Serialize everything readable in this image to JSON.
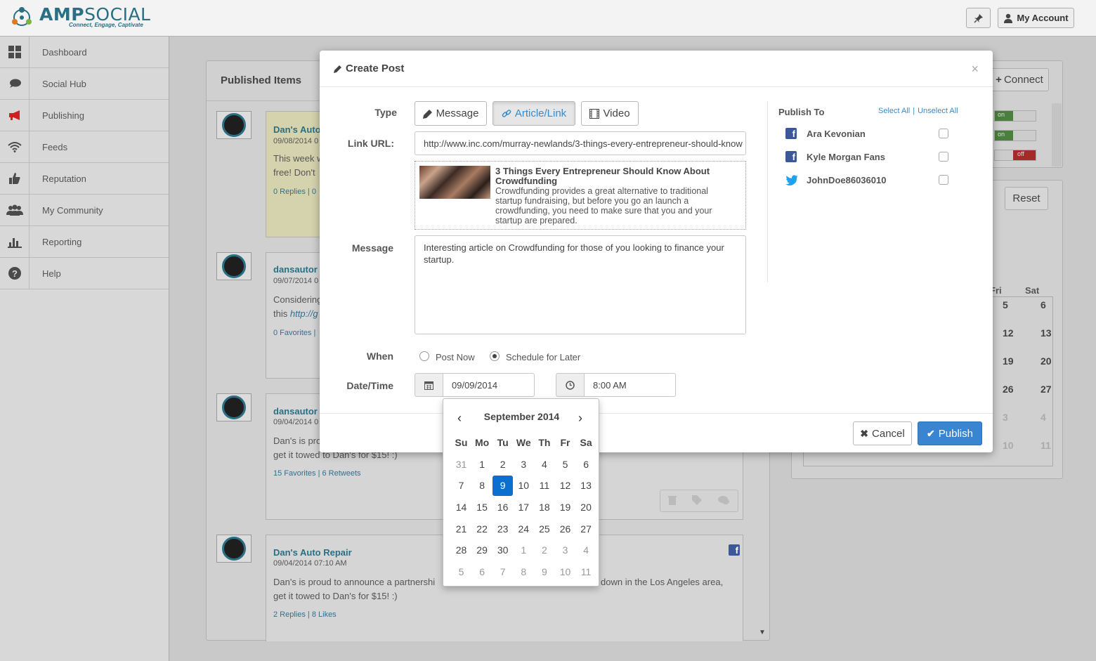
{
  "app": {
    "logo_amp": "AMP",
    "logo_social": "SOCIAL",
    "tagline": "Connect, Engage, Captivate",
    "my_account": "My Account"
  },
  "sidebar": {
    "items": [
      {
        "label": "Dashboard",
        "icon": "dashboard-icon"
      },
      {
        "label": "Social Hub",
        "icon": "chat-icon"
      },
      {
        "label": "Publishing",
        "icon": "megaphone-icon"
      },
      {
        "label": "Feeds",
        "icon": "wifi-icon"
      },
      {
        "label": "Reputation",
        "icon": "thumbs-up-icon"
      },
      {
        "label": "My Community",
        "icon": "users-icon"
      },
      {
        "label": "Reporting",
        "icon": "bar-chart-icon"
      },
      {
        "label": "Help",
        "icon": "question-icon"
      }
    ]
  },
  "published": {
    "title": "Published Items",
    "posts": [
      {
        "author": "Dan's Auto",
        "date": "09/08/2014 0",
        "text1": "This week w",
        "text2": "free! Don't",
        "stats": "0 Replies | 0"
      },
      {
        "author": "dansautor",
        "date": "09/07/2014 0",
        "text1": "Considering",
        "text2": "this",
        "link": "http://g",
        "stats": "0 Favorites |"
      },
      {
        "author": "dansautor",
        "date": "09/04/2014 0",
        "text1": "Dan's is pro",
        "text2": "get it towed to Dan's for $15! :)",
        "stats": "15 Favorites | 6 Retweets"
      },
      {
        "author": "Dan's Auto Repair",
        "date": "09/04/2014 07:10 AM",
        "text1": "Dan's is proud to announce a partnershi",
        "text1b": "down in the Los Angeles area,",
        "text2": "get it towed to Dan's for $15! :)",
        "stats": "2 Replies | 8 Likes"
      }
    ]
  },
  "right_panel": {
    "connect": "Connect",
    "toggles": [
      "on",
      "on",
      "off"
    ],
    "reset": "Reset",
    "day_fri": "Fri",
    "day_sat": "Sat",
    "cal_rows": [
      [
        "5",
        "6"
      ],
      [
        "12",
        "13"
      ],
      [
        "19",
        "20"
      ],
      [
        "26",
        "27"
      ],
      [
        "3",
        "4"
      ],
      [
        "10",
        "11"
      ]
    ]
  },
  "modal": {
    "title": "Create Post",
    "close": "×",
    "type_label": "Type",
    "type_buttons": [
      "Message",
      "Article/Link",
      "Video"
    ],
    "active_type": "Article/Link",
    "link_label": "Link URL:",
    "link_value": "http://www.inc.com/murray-newlands/3-things-every-entrepreneur-should-know",
    "preview": {
      "title": "3 Things Every Entrepreneur Should Know About Crowdfunding",
      "description": "Crowdfunding provides a great alternative to traditional startup fundraising, but before you go an launch a crowdfunding, you need to make sure that you and your startup are prepared."
    },
    "message_label": "Message",
    "message_value": "Interesting article on Crowdfunding for those of you looking to finance your startup.",
    "when_label": "When",
    "when_options": [
      "Post Now",
      "Schedule for Later"
    ],
    "when_selected": "Schedule for Later",
    "datetime_label": "Date/Time",
    "date_value": "09/09/2014",
    "time_value": "8:00 AM",
    "publish_to": {
      "title": "Publish To",
      "select_all": "Select All",
      "separator": "|",
      "unselect_all": "Unselect All",
      "accounts": [
        {
          "name": "Ara Kevonian",
          "network": "facebook",
          "checked": false
        },
        {
          "name": "Kyle Morgan Fans",
          "network": "facebook",
          "checked": false
        },
        {
          "name": "JohnDoe86036010",
          "network": "twitter",
          "checked": false
        }
      ]
    },
    "cancel": "Cancel",
    "publish": "Publish"
  },
  "calendar": {
    "month": "September 2014",
    "prev": "‹",
    "next": "›",
    "weekdays": [
      "Su",
      "Mo",
      "Tu",
      "We",
      "Th",
      "Fr",
      "Sa"
    ],
    "weeks": [
      [
        "31",
        "1",
        "2",
        "3",
        "4",
        "5",
        "6"
      ],
      [
        "7",
        "8",
        "9",
        "10",
        "11",
        "12",
        "13"
      ],
      [
        "14",
        "15",
        "16",
        "17",
        "18",
        "19",
        "20"
      ],
      [
        "21",
        "22",
        "23",
        "24",
        "25",
        "26",
        "27"
      ],
      [
        "28",
        "29",
        "30",
        "1",
        "2",
        "3",
        "4"
      ],
      [
        "5",
        "6",
        "7",
        "8",
        "9",
        "10",
        "11"
      ]
    ],
    "selected": "9"
  },
  "colors": {
    "accent": "#3a8ac7",
    "primary_button": "#3a85d2",
    "selected_day": "#0a6fcf",
    "brand": "#2a6f83",
    "facebook": "#3b5998",
    "twitter": "#1da1f2",
    "link": "#31708f",
    "backdrop": "#c9c9c9"
  }
}
